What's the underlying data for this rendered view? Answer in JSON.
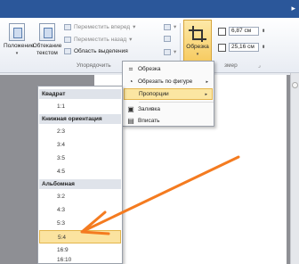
{
  "ribbon": {
    "position_label": "Положение",
    "wrap_label": "Обтекание текстом",
    "bring_forward": "Переместить вперед",
    "send_backward": "Переместить назад",
    "selection_pane": "Область выделения",
    "arrange_group": "Упорядочить",
    "crop_label": "Обрезка",
    "height_value": "6,87 см",
    "width_value": "25,16 см",
    "size_group": "змер"
  },
  "crop_menu": {
    "items": [
      {
        "label": "Обрезка",
        "icon": "crop-icon"
      },
      {
        "label": "Обрезать по фигуре",
        "icon": "shape-icon"
      },
      {
        "label": "Пропорции",
        "icon": "none",
        "highlighted": true
      },
      {
        "label": "Заливка",
        "icon": "fill-icon"
      },
      {
        "label": "Вписать",
        "icon": "fit-icon"
      }
    ]
  },
  "ratio_menu": {
    "square_header": "Квадрат",
    "square_items": [
      "1:1"
    ],
    "portrait_header": "Книжная ориентация",
    "portrait_items": [
      "2:3",
      "3:4",
      "3:5",
      "4:5"
    ],
    "landscape_header": "Альбомная",
    "landscape_items": [
      "3:2",
      "4:3",
      "5:3",
      "5:4",
      "16:9",
      "16:10"
    ],
    "selected": "5:4"
  },
  "colors": {
    "highlight": "#fbe3a0",
    "arrow": "#f47b20",
    "ribbon_accent": "#2b579a"
  }
}
